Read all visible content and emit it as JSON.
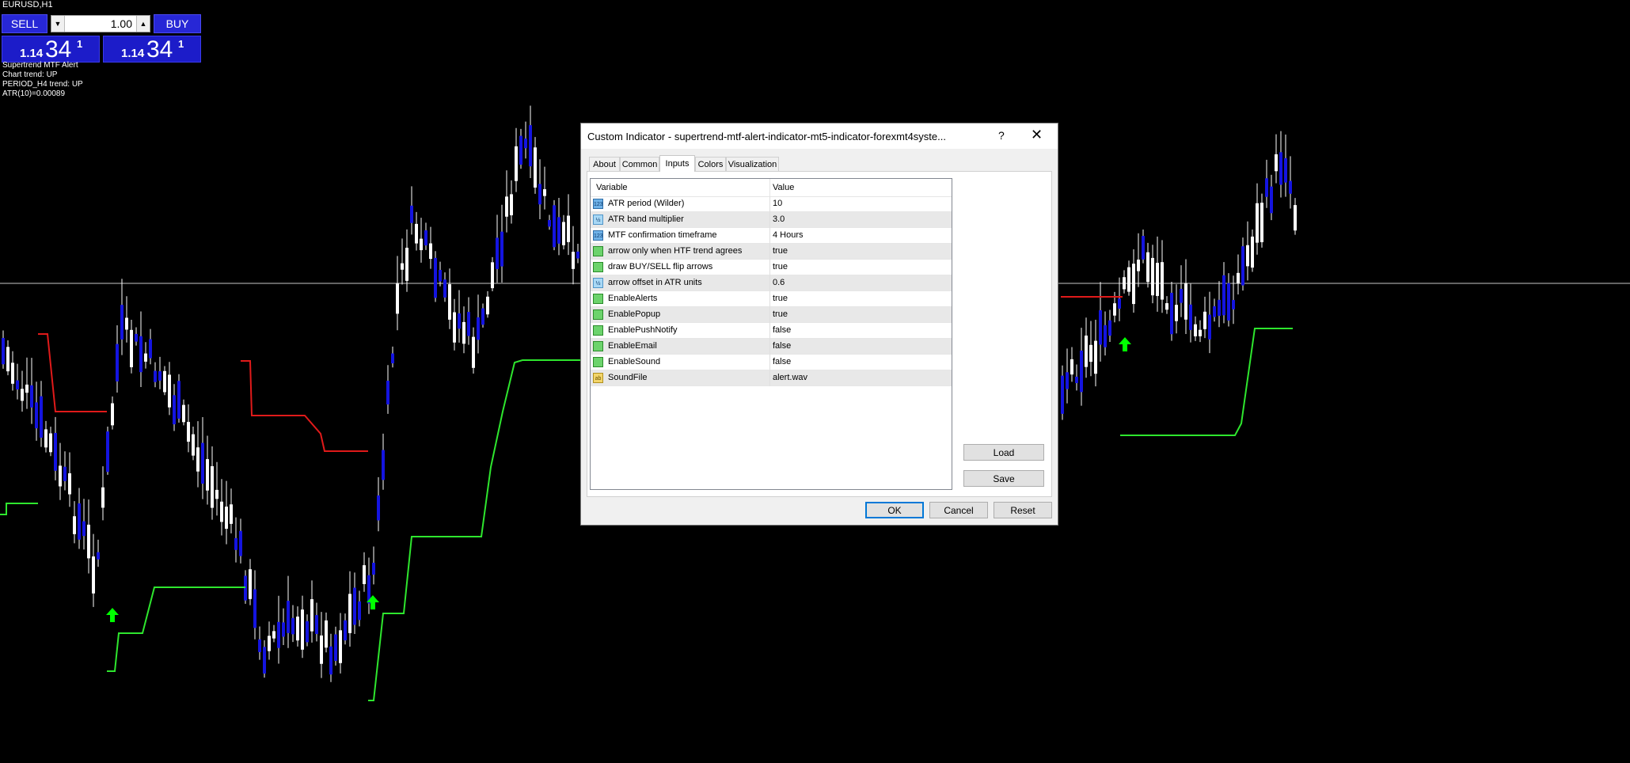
{
  "chart": {
    "symbol": "EURUSD,H1",
    "colors": {
      "bull_candle": "#ffffff",
      "bear_candle": "#1414e0",
      "trend_up": "#2ee62e",
      "trend_down": "#e01a1a",
      "arrow": "#00ff00",
      "background": "#000000"
    }
  },
  "trade_panel": {
    "sell_label": "SELL",
    "buy_label": "BUY",
    "lot_value": "1.00",
    "bid": {
      "small": "1.14",
      "big": "34",
      "sup": "1"
    },
    "ask": {
      "small": "1.14",
      "big": "34",
      "sup": "1"
    }
  },
  "indicator_info": [
    "Supertrend MTF Alert",
    "Chart trend: UP",
    "PERIOD_H4 trend: UP",
    "ATR(10)=0.00089"
  ],
  "dialog": {
    "title": "Custom Indicator - supertrend-mtf-alert-indicator-mt5-indicator-forexmt4syste...",
    "help": "?",
    "close": "✕",
    "tabs": [
      "About",
      "Common",
      "Inputs",
      "Colors",
      "Visualization"
    ],
    "active_tab": "Inputs",
    "columns": {
      "variable": "Variable",
      "value": "Value"
    },
    "inputs": [
      {
        "type": "int",
        "icon": "123",
        "name": "ATR period (Wilder)",
        "value": "10"
      },
      {
        "type": "dbl",
        "icon": "½",
        "name": "ATR band multiplier",
        "value": "3.0"
      },
      {
        "type": "int",
        "icon": "123",
        "name": "MTF confirmation timeframe",
        "value": "4 Hours"
      },
      {
        "type": "bool",
        "icon": "",
        "name": "arrow only when HTF trend agrees",
        "value": "true"
      },
      {
        "type": "bool",
        "icon": "",
        "name": "draw BUY/SELL flip arrows",
        "value": "true"
      },
      {
        "type": "dbl",
        "icon": "½",
        "name": "arrow offset in ATR units",
        "value": "0.6"
      },
      {
        "type": "bool",
        "icon": "",
        "name": "EnableAlerts",
        "value": "true"
      },
      {
        "type": "bool",
        "icon": "",
        "name": "EnablePopup",
        "value": "true"
      },
      {
        "type": "bool",
        "icon": "",
        "name": "EnablePushNotify",
        "value": "false"
      },
      {
        "type": "bool",
        "icon": "",
        "name": "EnableEmail",
        "value": "false"
      },
      {
        "type": "bool",
        "icon": "",
        "name": "EnableSound",
        "value": "false"
      },
      {
        "type": "str",
        "icon": "ab",
        "name": "SoundFile",
        "value": "alert.wav"
      }
    ],
    "buttons": {
      "load": "Load",
      "save": "Save",
      "ok": "OK",
      "cancel": "Cancel",
      "reset": "Reset"
    }
  }
}
